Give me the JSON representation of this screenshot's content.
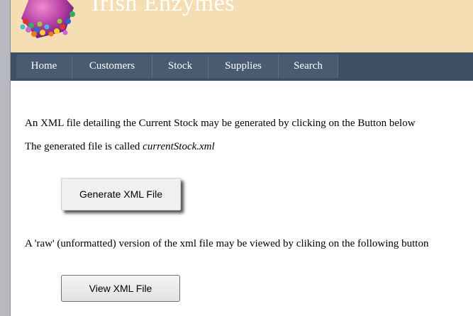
{
  "header": {
    "site_title": "Irish Enzymes"
  },
  "nav": [
    {
      "label": "Home"
    },
    {
      "label": "Customers"
    },
    {
      "label": "Stock"
    },
    {
      "label": "Supplies"
    },
    {
      "label": "Search"
    }
  ],
  "main": {
    "intro": "An XML file detailing the Current Stock may be generated by clicking on the Button below",
    "generated_prefix": "The generated file is called",
    "filename": "currentStock.xml",
    "generate_button": "Generate XML File",
    "raw_text": "A 'raw' (unformatted) version of the xml file may be viewed by cliking on the following button",
    "view_button": "View XML File"
  }
}
